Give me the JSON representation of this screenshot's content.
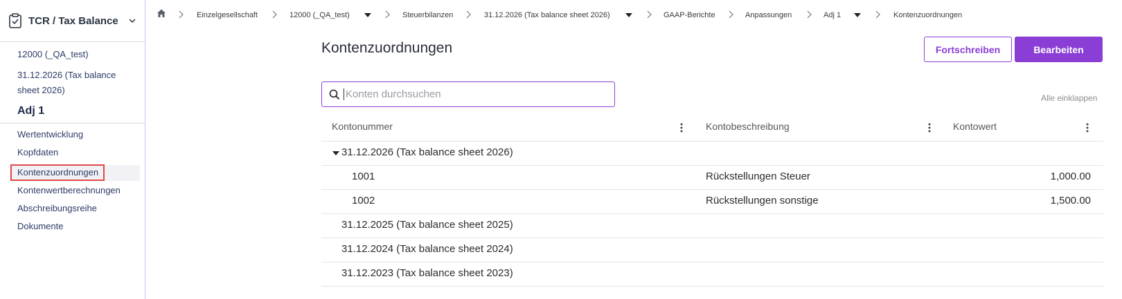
{
  "app": {
    "title": "TCR / Tax Balance"
  },
  "sidebar": {
    "context_company": "12000 (_QA_test)",
    "context_period": "31.12.2026 (Tax balance sheet 2026)",
    "context_adj": "Adj 1",
    "items": [
      {
        "label": "Wertentwicklung"
      },
      {
        "label": "Kopfdaten"
      },
      {
        "label": "Kontenzuordnungen",
        "active": true
      },
      {
        "label": "Kontenwertberechnungen"
      },
      {
        "label": "Abschreibungsreihe"
      },
      {
        "label": "Dokumente"
      }
    ]
  },
  "breadcrumb": [
    {
      "label": "Einzelgesellschaft"
    },
    {
      "label": "12000 (_QA_test)",
      "dropdown": true
    },
    {
      "label": "Steuerbilanzen"
    },
    {
      "label": "31.12.2026 (Tax balance sheet 2026)",
      "dropdown": true
    },
    {
      "label": "GAAP-Berichte"
    },
    {
      "label": "Anpassungen"
    },
    {
      "label": "Adj 1",
      "dropdown": true
    },
    {
      "label": "Kontenzuordnungen"
    }
  ],
  "page": {
    "title": "Kontenzuordnungen",
    "fortschreiben_label": "Fortschreiben",
    "bearbeiten_label": "Bearbeiten",
    "search_placeholder": "Konten durchsuchen",
    "collapse_all_label": "Alle einklappen"
  },
  "table": {
    "columns": [
      "Kontonummer",
      "Kontobeschreibung",
      "Kontowert"
    ],
    "groups": [
      {
        "label": "31.12.2026 (Tax balance sheet 2026)",
        "expanded": true,
        "rows": [
          {
            "number": "1001",
            "description": "Rückstellungen Steuer",
            "value": "1,000.00"
          },
          {
            "number": "1002",
            "description": "Rückstellungen sonstige",
            "value": "1,500.00"
          }
        ]
      },
      {
        "label": "31.12.2025 (Tax balance sheet 2025)",
        "expanded": false
      },
      {
        "label": "31.12.2024 (Tax balance sheet 2024)",
        "expanded": false
      },
      {
        "label": "31.12.2023 (Tax balance sheet 2023)",
        "expanded": false
      }
    ]
  },
  "colors": {
    "accent": "#8a3ed6",
    "highlight_box": "#e04848"
  }
}
